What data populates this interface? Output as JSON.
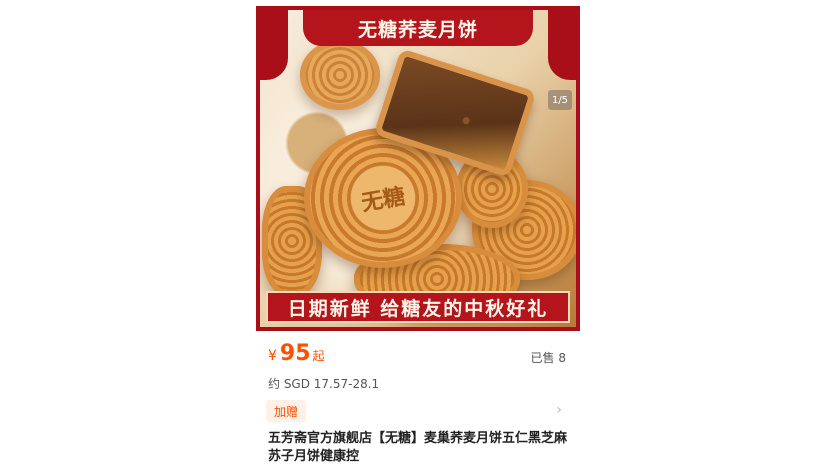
{
  "image": {
    "top_banner": "无糖荞麦月饼",
    "bottom_banner": "日期新鲜  给糖友的中秋好礼",
    "stamp_text": "无糖",
    "page_indicator": "1/5"
  },
  "price": {
    "currency": "¥",
    "value": "95",
    "suffix": "起"
  },
  "sold": "已售 8",
  "approx_price": "约 SGD 17.57-28.1",
  "tag": "加赠",
  "title": "五芳斋官方旗舰店【无糖】麦巢荞麦月饼五仁黑芝麻苏子月饼健康控",
  "colors": {
    "accent": "#ff5000",
    "banner_red": "#b4141c"
  },
  "icons": {
    "chevron": "chevron-right-icon"
  }
}
